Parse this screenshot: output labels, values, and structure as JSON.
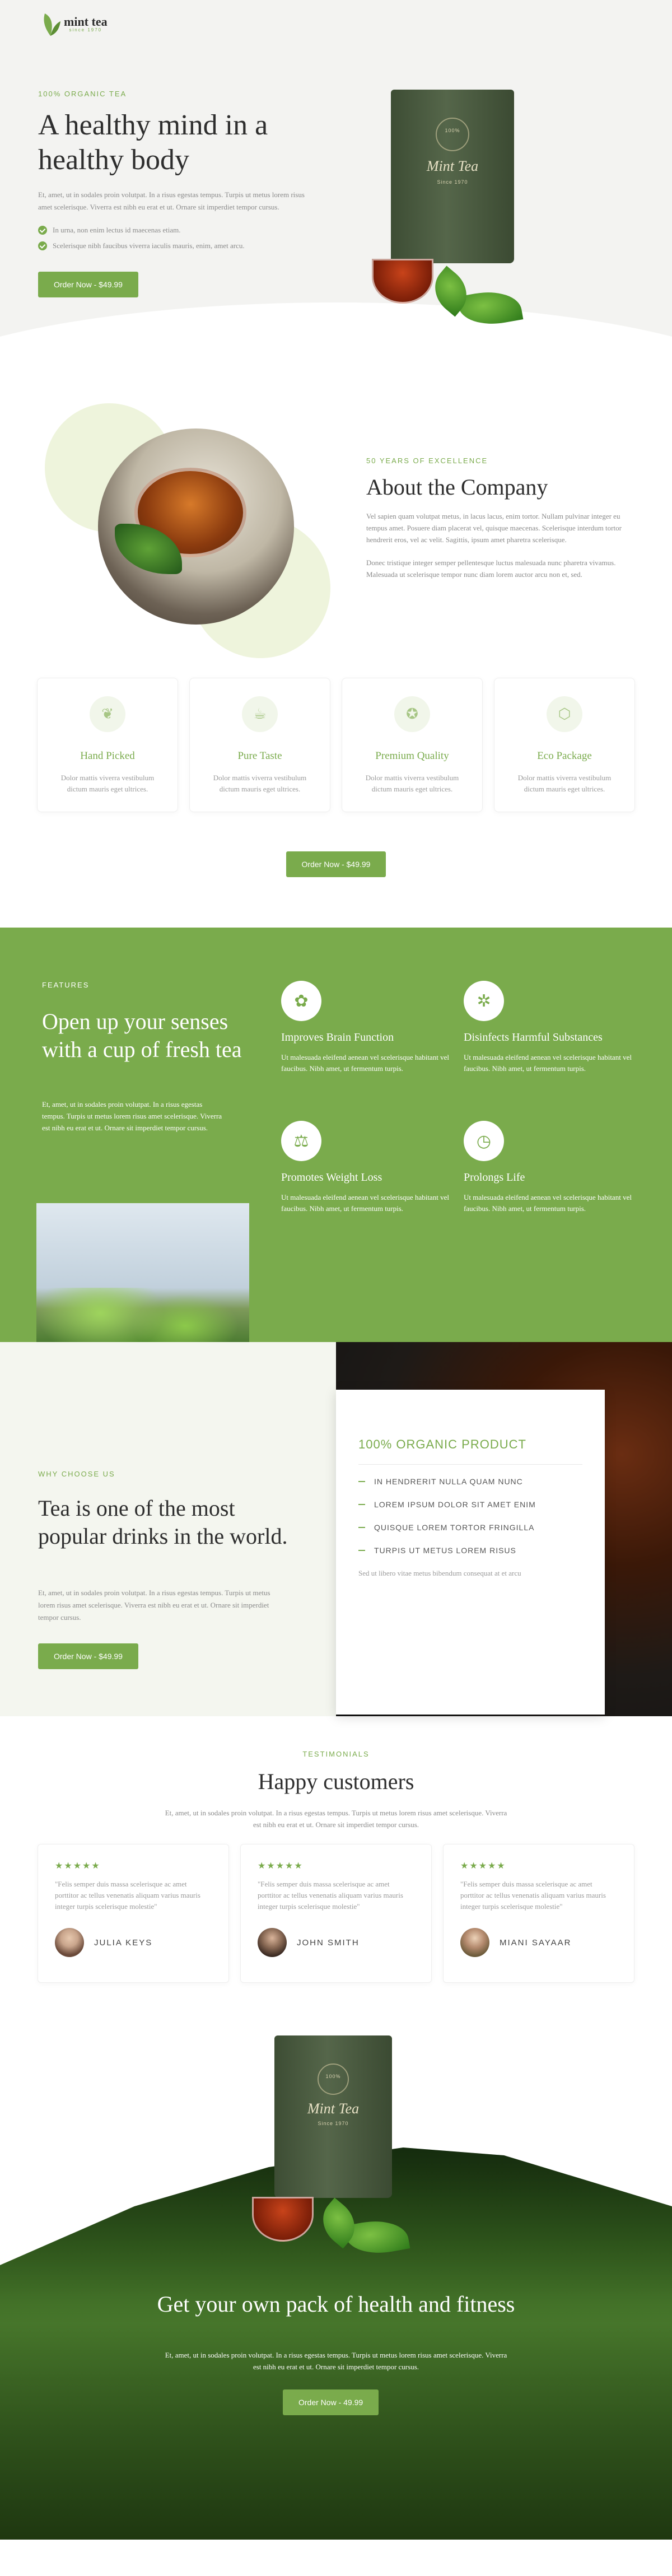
{
  "brand": {
    "name": "mint tea",
    "tagline": "since 1970"
  },
  "hero": {
    "eyebrow": "100% ORGANIC TEA",
    "title": "A healthy mind in a healthy body",
    "text": "Et, amet, ut in sodales proin volutpat. In a risus egestas tempus. Turpis ut metus lorem risus amet scelerisque. Viverra est nibh eu erat et ut. Ornare sit imperdiet tempor cursus.",
    "checks": [
      "In urna, non enim lectus id maecenas etiam.",
      "Scelerisque nibh faucibus viverra iaculis mauris, enim, amet arcu."
    ],
    "cta": "Order Now - $49.99"
  },
  "product": {
    "name": "Mint Tea",
    "since": "Since 1970",
    "badge": "100%"
  },
  "about": {
    "eyebrow": "50 YEARS OF EXCELLENCE",
    "title": "About the Company",
    "p1": "Vel sapien quam volutpat metus, in lacus lacus, enim tortor. Nullam pulvinar integer eu tempus amet. Posuere diam placerat vel, quisque maecenas. Scelerisque interdum tortor hendrerit eros, vel ac velit. Sagittis, ipsum amet pharetra scelerisque.",
    "p2": "Donec tristique integer semper pellentesque luctus malesuada nunc pharetra vivamus. Malesuada ut scelerisque tempor nunc diam lorem auctor arcu non et, sed."
  },
  "cards": [
    {
      "title": "Hand Picked",
      "text": "Dolor mattis viverra vestibulum dictum mauris eget ultrices.",
      "icon": "leaf-icon",
      "glyph": "❦"
    },
    {
      "title": "Pure Taste",
      "text": "Dolor mattis viverra vestibulum dictum mauris eget ultrices.",
      "icon": "cup-icon",
      "glyph": "☕"
    },
    {
      "title": "Premium Quality",
      "text": "Dolor mattis viverra vestibulum dictum mauris eget ultrices.",
      "icon": "award-icon",
      "glyph": "✪"
    },
    {
      "title": "Eco Package",
      "text": "Dolor mattis viverra vestibulum dictum mauris eget ultrices.",
      "icon": "box-icon",
      "glyph": "⬡"
    }
  ],
  "cards_cta": "Order Now - $49.99",
  "features": {
    "eyebrow": "FEATURES",
    "title": "Open up your senses with a cup of fresh tea",
    "text": "Et, amet, ut in sodales proin volutpat. In a risus egestas tempus. Turpis ut metus lorem risus amet scelerisque. Viverra est nibh eu erat et ut. Ornare sit imperdiet tempor cursus.",
    "items": [
      {
        "title": "Improves Brain Function",
        "text": "Ut malesuada eleifend aenean vel scelerisque habitant vel faucibus. Nibh amet, ut fermentum turpis.",
        "icon": "brain-icon",
        "glyph": "✿"
      },
      {
        "title": "Disinfects Harmful Substances",
        "text": "Ut malesuada eleifend aenean vel scelerisque habitant vel faucibus. Nibh amet, ut fermentum turpis.",
        "icon": "molecule-icon",
        "glyph": "✲"
      },
      {
        "title": "Promotes Weight Loss",
        "text": "Ut malesuada eleifend aenean vel scelerisque habitant vel faucibus. Nibh amet, ut fermentum turpis.",
        "icon": "scale-icon",
        "glyph": "⚖"
      },
      {
        "title": "Prolongs Life",
        "text": "Ut malesuada eleifend aenean vel scelerisque habitant vel faucibus. Nibh amet, ut fermentum turpis.",
        "icon": "clock-icon",
        "glyph": "◷"
      }
    ]
  },
  "why": {
    "eyebrow": "WHY CHOOSE US",
    "title": "Tea is one of the most popular drinks in the world.",
    "text": "Et, amet, ut in sodales proin volutpat. In a risus egestas tempus. Turpis ut metus lorem risus amet scelerisque. Viverra est nibh eu erat et ut. Ornare sit imperdiet tempor cursus.",
    "cta": "Order Now - $49.99",
    "card_title": "100% ORGANIC PRODUCT",
    "list": [
      "IN HENDRERIT NULLA QUAM NUNC",
      "LOREM IPSUM DOLOR SIT AMET ENIM",
      "QUISQUE LOREM TORTOR FRINGILLA",
      "TURPIS UT METUS LOREM RISUS"
    ],
    "note": "Sed ut libero vitae metus bibendum consequat at et arcu"
  },
  "testimonials": {
    "eyebrow": "TESTIMONIALS",
    "title": "Happy customers",
    "intro": "Et, amet, ut in sodales proin volutpat. In a risus egestas tempus. Turpis ut metus lorem risus amet scelerisque. Viverra est nibh eu erat et ut. Ornare sit imperdiet tempor cursus.",
    "items": [
      {
        "stars": "★★★★★",
        "quote": "\"Felis semper duis massa scelerisque ac amet porttitor ac tellus venenatis aliquam varius mauris integer turpis scelerisque molestie\"",
        "name": "JULIA KEYS",
        "avatar": "#c9a58c"
      },
      {
        "stars": "★★★★★",
        "quote": "\"Felis semper duis massa scelerisque ac amet porttitor ac tellus venenatis aliquam varius mauris integer turpis scelerisque molestie\"",
        "name": "JOHN SMITH",
        "avatar": "#8a6a55"
      },
      {
        "stars": "★★★★★",
        "quote": "\"Felis semper duis massa scelerisque ac amet porttitor ac tellus venenatis aliquam varius mauris integer turpis scelerisque molestie\"",
        "name": "MIANI SAYAAR",
        "avatar": "#b48a6e"
      }
    ]
  },
  "cta": {
    "title": "Get your own pack of health and fitness",
    "text": "Et, amet, ut in sodales proin volutpat. In a risus egestas tempus. Turpis ut metus lorem risus amet scelerisque. Viverra est nibh eu erat et ut. Ornare sit imperdiet tempor cursus.",
    "button": "Order Now - 49.99"
  },
  "colors": {
    "accent": "#7aab4c",
    "dark_text": "#2e2e2e"
  }
}
